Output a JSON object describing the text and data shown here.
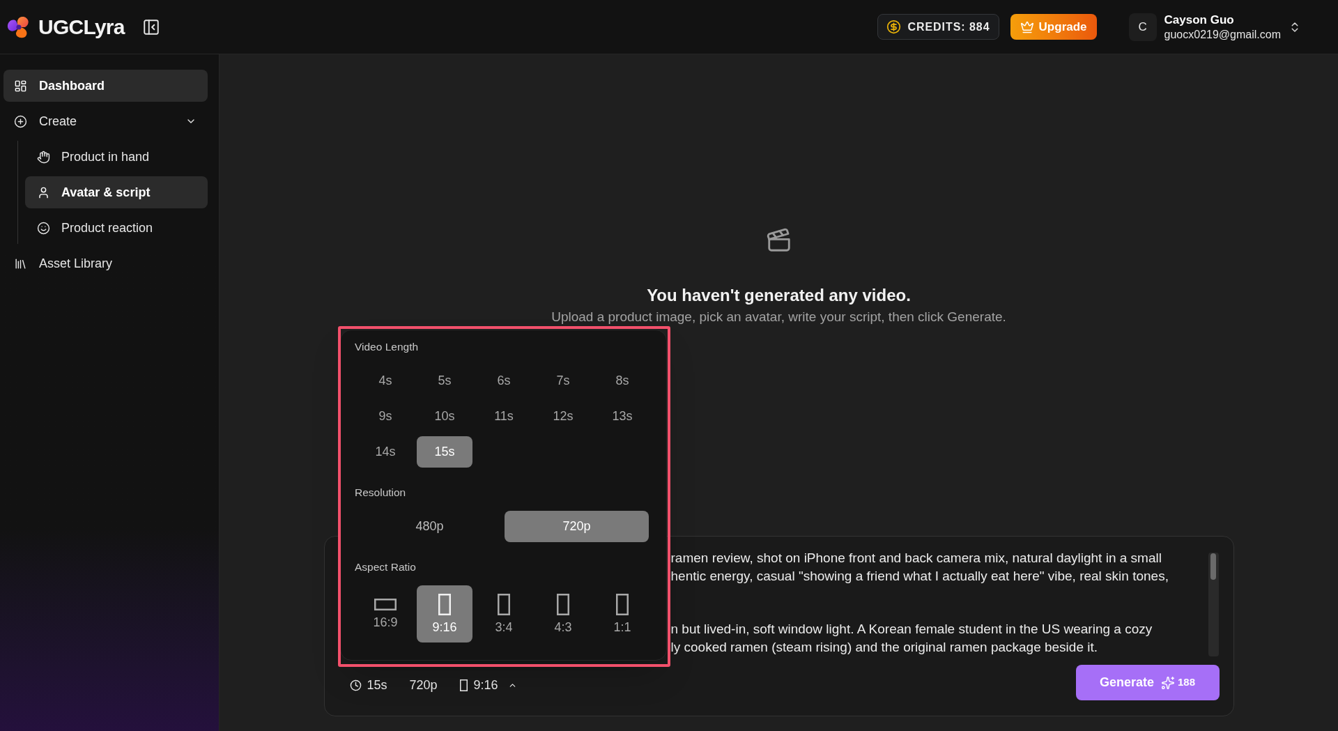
{
  "header": {
    "brand": "UGCLyra",
    "credits": "CREDITS: 884",
    "upgrade": "Upgrade",
    "user": {
      "initial": "C",
      "name": "Cayson Guo",
      "email": "guocx0219@gmail.com"
    }
  },
  "sidebar": {
    "items": [
      {
        "label": "Dashboard",
        "selected": true
      },
      {
        "label": "Create",
        "selected": false,
        "expanded": true,
        "children": [
          {
            "label": "Product in hand",
            "selected": false
          },
          {
            "label": "Avatar & script",
            "selected": true
          },
          {
            "label": "Product reaction",
            "selected": false
          }
        ]
      },
      {
        "label": "Asset Library",
        "selected": false
      }
    ]
  },
  "empty_state": {
    "title": "You haven't generated any video.",
    "subtitle": "Upload a product image, pick an avatar, write your script, then click Generate."
  },
  "settings_popup": {
    "highlighted": true,
    "sections": [
      {
        "label": "Video Length",
        "kind": "grid",
        "options": [
          {
            "label": "4s",
            "selected": false
          },
          {
            "label": "5s",
            "selected": false
          },
          {
            "label": "6s",
            "selected": false
          },
          {
            "label": "7s",
            "selected": false
          },
          {
            "label": "8s",
            "selected": false
          },
          {
            "label": "9s",
            "selected": false
          },
          {
            "label": "10s",
            "selected": false
          },
          {
            "label": "11s",
            "selected": false
          },
          {
            "label": "12s",
            "selected": false
          },
          {
            "label": "13s",
            "selected": false
          },
          {
            "label": "14s",
            "selected": false
          },
          {
            "label": "15s",
            "selected": true
          }
        ]
      },
      {
        "label": "Resolution",
        "kind": "segmented",
        "options": [
          {
            "label": "480p",
            "selected": false
          },
          {
            "label": "720p",
            "selected": true
          }
        ]
      },
      {
        "label": "Aspect Ratio",
        "kind": "ratio",
        "options": [
          {
            "label": "16:9",
            "kind": "landscape",
            "selected": false
          },
          {
            "label": "9:16",
            "kind": "portrait",
            "selected": true
          },
          {
            "label": "3:4",
            "kind": "portrait",
            "selected": false
          },
          {
            "label": "4:3",
            "kind": "portrait",
            "selected": false
          },
          {
            "label": "1:1",
            "kind": "portrait",
            "selected": false
          }
        ]
      }
    ]
  },
  "prompt": {
    "script_blocks": [
      [
        "ramen review, shot on iPhone front and back camera mix, natural daylight in a small",
        "hentic energy, casual \"showing a friend what I actually eat here\" vibe, real skin tones,"
      ],
      [
        "n but lived-in, soft window light. A Korean female student in the US wearing a cozy",
        "ly cooked ramen (steam rising) and the original ramen package beside it."
      ]
    ],
    "summary": {
      "duration": "15s",
      "resolution": "720p",
      "aspect": "9:16",
      "expanded": true
    },
    "generate": {
      "label": "Generate",
      "cost": "188"
    }
  }
}
